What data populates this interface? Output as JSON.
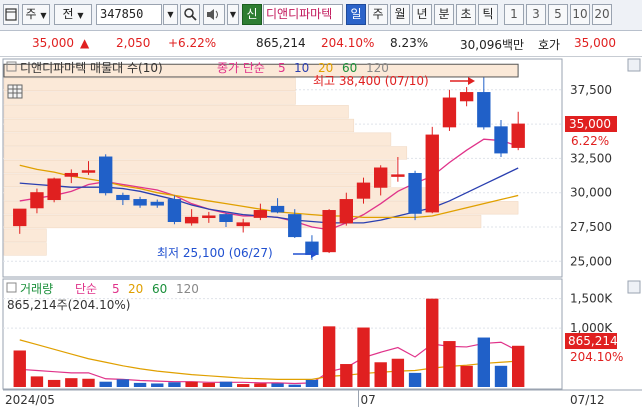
{
  "toolbar": {
    "period_label": "주",
    "prev_label": "전",
    "stock_code": "347850",
    "credit_label": "신",
    "company_name": "디앤디파마텍",
    "tabs": [
      "일",
      "주",
      "월",
      "년",
      "분",
      "초",
      "틱"
    ],
    "active_tab": "일",
    "numbers": [
      "1",
      "3",
      "5",
      "10",
      "20"
    ]
  },
  "infobar": {
    "price": "35,000",
    "change": "2,050",
    "change_pct": "+6.22%",
    "volume": "865,214",
    "volume_ratio": "204.10%",
    "turnover_pct": "8.23%",
    "trade_value": "30,096백만",
    "quote_label": "호가",
    "quote_price": "35,000"
  },
  "price_chart": {
    "title": "디앤디파마텍 매물대 수(10)",
    "ma_label": "종가 단순",
    "ma_periods": [
      "5",
      "10",
      "20",
      "60",
      "120"
    ],
    "ma_colors": [
      "#e0338a",
      "#2a3fb0",
      "#e0a000",
      "#1a8f3a",
      "#888888"
    ],
    "high_label": "최고 38,400 (07/10)",
    "low_label": "최저 25,100 (06/27)",
    "last_price": "35,000",
    "last_pct": "6.22%"
  },
  "volume_chart": {
    "title": "거래량",
    "ma_label": "단순",
    "ma_periods": [
      "5",
      "20",
      "60",
      "120"
    ],
    "ma_colors": [
      "#e0338a",
      "#e0a000",
      "#1a8f3a",
      "#888888"
    ],
    "volume_text": "865,214주(204.10%)",
    "last_volume": "865,214",
    "last_ratio": "204.10%"
  },
  "x_axis": {
    "labels": [
      {
        "text": "2024/05",
        "index": 0
      },
      {
        "text": "07",
        "index": 20
      },
      {
        "text": "07/12",
        "index": 31
      }
    ]
  },
  "chart_data": {
    "type": "candlestick",
    "y_price_ticks": [
      25000,
      27500,
      30000,
      32500,
      35000,
      37500
    ],
    "y_price_tick_labels": [
      "25,000",
      "27,500",
      "30,000",
      "32,500",
      "",
      "37,500"
    ],
    "price_ylim": [
      24000,
      39600
    ],
    "y_volume_ticks": [
      1500000,
      1000000
    ],
    "y_volume_tick_labels": [
      "1,500K",
      "1,000K"
    ],
    "volume_ylim": [
      0,
      1800000
    ],
    "candles": [
      {
        "o": 27600,
        "h": 28800,
        "l": 27000,
        "c": 28800
      },
      {
        "o": 28900,
        "h": 30300,
        "l": 28500,
        "c": 30000
      },
      {
        "o": 29500,
        "h": 31100,
        "l": 29300,
        "c": 31000
      },
      {
        "o": 31200,
        "h": 31700,
        "l": 30700,
        "c": 31400
      },
      {
        "o": 31600,
        "h": 32300,
        "l": 31300,
        "c": 31600
      },
      {
        "o": 32600,
        "h": 32800,
        "l": 29800,
        "c": 30000
      },
      {
        "o": 29800,
        "h": 30000,
        "l": 29100,
        "c": 29500
      },
      {
        "o": 29500,
        "h": 29700,
        "l": 28900,
        "c": 29100
      },
      {
        "o": 29300,
        "h": 29500,
        "l": 28900,
        "c": 29100
      },
      {
        "o": 29500,
        "h": 29800,
        "l": 27700,
        "c": 27900
      },
      {
        "o": 27800,
        "h": 28800,
        "l": 27600,
        "c": 28200
      },
      {
        "o": 28200,
        "h": 28600,
        "l": 27800,
        "c": 28300
      },
      {
        "o": 28400,
        "h": 28500,
        "l": 27500,
        "c": 27900
      },
      {
        "o": 27600,
        "h": 28100,
        "l": 27100,
        "c": 27800
      },
      {
        "o": 28200,
        "h": 29200,
        "l": 28000,
        "c": 28700
      },
      {
        "o": 29000,
        "h": 29600,
        "l": 28500,
        "c": 28600
      },
      {
        "o": 28400,
        "h": 28800,
        "l": 26700,
        "c": 26800
      },
      {
        "o": 26400,
        "h": 26900,
        "l": 25100,
        "c": 25500
      },
      {
        "o": 25700,
        "h": 28800,
        "l": 25600,
        "c": 28700
      },
      {
        "o": 27800,
        "h": 30000,
        "l": 27600,
        "c": 29500
      },
      {
        "o": 29600,
        "h": 31100,
        "l": 29200,
        "c": 30700
      },
      {
        "o": 30400,
        "h": 32000,
        "l": 29800,
        "c": 31800
      },
      {
        "o": 31200,
        "h": 32600,
        "l": 30800,
        "c": 31300
      },
      {
        "o": 31400,
        "h": 31600,
        "l": 28000,
        "c": 28500
      },
      {
        "o": 28600,
        "h": 34800,
        "l": 28500,
        "c": 34200
      },
      {
        "o": 34800,
        "h": 37500,
        "l": 34500,
        "c": 36900
      },
      {
        "o": 36700,
        "h": 37700,
        "l": 36300,
        "c": 37300
      },
      {
        "o": 37300,
        "h": 38400,
        "l": 34600,
        "c": 34800
      },
      {
        "o": 34800,
        "h": 35300,
        "l": 32600,
        "c": 32900
      },
      {
        "o": 33300,
        "h": 35900,
        "l": 33100,
        "c": 35000
      }
    ],
    "volumes": [
      620000,
      180000,
      120000,
      150000,
      140000,
      90000,
      130000,
      70000,
      60000,
      80000,
      90000,
      70000,
      90000,
      50000,
      60000,
      60000,
      40000,
      120000,
      1030000,
      390000,
      1010000,
      420000,
      480000,
      240000,
      1500000,
      780000,
      360000,
      840000,
      360000,
      700000
    ],
    "ma_price": [
      {
        "name": "5",
        "values": [
          29400,
          29600,
          29800,
          30100,
          30600,
          30800,
          30600,
          30400,
          30200,
          29800,
          29200,
          28800,
          28500,
          28300,
          28300,
          28200,
          27900,
          27500,
          27300,
          27800,
          28400,
          29200,
          30100,
          30700,
          31200,
          32200,
          33100,
          33900,
          33800,
          33400
        ]
      },
      {
        "name": "10",
        "values": [
          30700,
          30600,
          30500,
          30400,
          30400,
          30400,
          30300,
          30100,
          29800,
          29500,
          29100,
          28800,
          28600,
          28400,
          28300,
          28200,
          28000,
          27900,
          27800,
          27800,
          27800,
          28000,
          28300,
          28600,
          28900,
          29400,
          30000,
          30600,
          31200,
          31800
        ]
      },
      {
        "name": "20",
        "values": [
          32000,
          31700,
          31500,
          31200,
          31000,
          30800,
          30500,
          30300,
          30000,
          29800,
          29600,
          29400,
          29200,
          29000,
          28800,
          28600,
          28500,
          28400,
          28300,
          28300,
          28200,
          28200,
          28200,
          28200,
          28300,
          28600,
          28900,
          29200,
          29500,
          29800
        ]
      }
    ],
    "ma_volume": [
      {
        "name": "5",
        "values": [
          300000,
          280000,
          260000,
          240000,
          240000,
          140000,
          130000,
          110000,
          100000,
          90000,
          90000,
          80000,
          80000,
          80000,
          70000,
          70000,
          60000,
          70000,
          260000,
          330000,
          500000,
          590000,
          670000,
          510000,
          730000,
          690000,
          680000,
          740000,
          760000,
          610000
        ]
      },
      {
        "name": "20",
        "values": [
          800000,
          720000,
          640000,
          560000,
          480000,
          420000,
          360000,
          310000,
          270000,
          240000,
          210000,
          190000,
          170000,
          150000,
          140000,
          130000,
          130000,
          130000,
          180000,
          200000,
          230000,
          250000,
          270000,
          280000,
          320000,
          350000,
          370000,
          400000,
          420000,
          440000
        ]
      }
    ],
    "volume_profile": [
      {
        "price_low": 38400,
        "price_high": 39400,
        "length": 0.97
      },
      {
        "price_low": 37400,
        "price_high": 38400,
        "length": 0.55
      },
      {
        "price_low": 36400,
        "price_high": 37400,
        "length": 0.55
      },
      {
        "price_low": 35400,
        "price_high": 36400,
        "length": 0.65
      },
      {
        "price_low": 34400,
        "price_high": 35400,
        "length": 0.66
      },
      {
        "price_low": 33400,
        "price_high": 34400,
        "length": 0.73
      },
      {
        "price_low": 32400,
        "price_high": 33400,
        "length": 0.76
      },
      {
        "price_low": 31400,
        "price_high": 32400,
        "length": 0.74
      },
      {
        "price_low": 30400,
        "price_high": 31400,
        "length": 0.73
      },
      {
        "price_low": 29400,
        "price_high": 30400,
        "length": 0.82
      },
      {
        "price_low": 28400,
        "price_high": 29400,
        "length": 0.97
      },
      {
        "price_low": 27400,
        "price_high": 28400,
        "length": 0.9
      },
      {
        "price_low": 26400,
        "price_high": 27400,
        "length": 0.08
      },
      {
        "price_low": 25400,
        "price_high": 26400,
        "length": 0.08
      }
    ]
  }
}
